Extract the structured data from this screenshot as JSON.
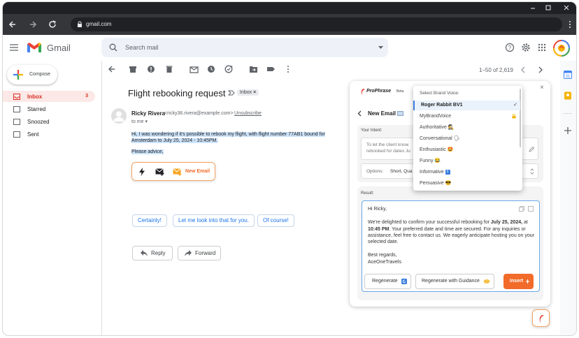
{
  "browser": {
    "url": "gmail.com"
  },
  "gmail": {
    "logo_text": "Gmail",
    "search_placeholder": "Search mail",
    "compose_label": "Compose",
    "nav": [
      {
        "label": "Inbox",
        "count": "3"
      },
      {
        "label": "Starred"
      },
      {
        "label": "Snoozed"
      },
      {
        "label": "Sent"
      }
    ],
    "pagination": "1–50 of 2,619"
  },
  "email": {
    "subject": "Flight rebooking request",
    "label_chip": "Inbox",
    "sender_name": "Ricky Rivera",
    "sender_email": "<ricky36.rivera@example.com>",
    "unsubscribe": "Unsubscribe",
    "to": "to me",
    "body_line1": "Hi, I was wondering if it's possible to rebook my flight, with flight number 77AB1 bound for",
    "body_line2": "Amsterdam to July 25, 2024 - 10:45PM.",
    "body_line3": "Please advice,",
    "new_email_label": "New Email",
    "smart_replies": [
      "Certainly!",
      "Let me look into that for you.",
      "Of course!"
    ],
    "reply_label": "Reply",
    "forward_label": "Forward"
  },
  "prophrase": {
    "logo_text": "ProPhrase",
    "beta": "Beta",
    "title": "New Email",
    "intent_label": "Your Intent:",
    "intent_text": "To let the client know",
    "intent_text2": "rebooked for dates Ju",
    "options_label": "Options:",
    "options_value": "Short, Qua",
    "result_label": "Result:",
    "result": {
      "greeting": "Hi Ricky,",
      "p1a": "We're delighted to confirm your successful rebooking for ",
      "p1b": "July 25, 2024,",
      "p1c": " at",
      "p2a": "10:45 PM",
      "p2b": ". Your preferred date and time are secured. For any inquiries or",
      "p3": "assistance, feel free to contact us. We eagerly anticipate hosting you on your",
      "p4": "selected date.",
      "signoff": "Best regards,",
      "signature": "AceOneTravels"
    },
    "regenerate": "Regenerate",
    "regenerate_guidance": "Regenerate with Guidance",
    "insert": "Insert",
    "brand_voice": {
      "header": "Select Brand Voice:",
      "items": [
        "Roger Rabbit BV1",
        "MyBrandVoice",
        "Authoritative",
        "Conversational",
        "Enthusiastic",
        "Funny",
        "Informative",
        "Persuasive"
      ],
      "emojis": [
        "",
        "",
        "🕵",
        "🗣",
        "🤩",
        "😂",
        "ℹ",
        "😎"
      ],
      "selected": "Roger Rabbit BV1"
    }
  },
  "colors": {
    "accent_blue": "#1a73e8",
    "inbox_highlight": "#fce8e6",
    "insert_orange": "#f26b2a",
    "gmail_red": "#d93025"
  }
}
